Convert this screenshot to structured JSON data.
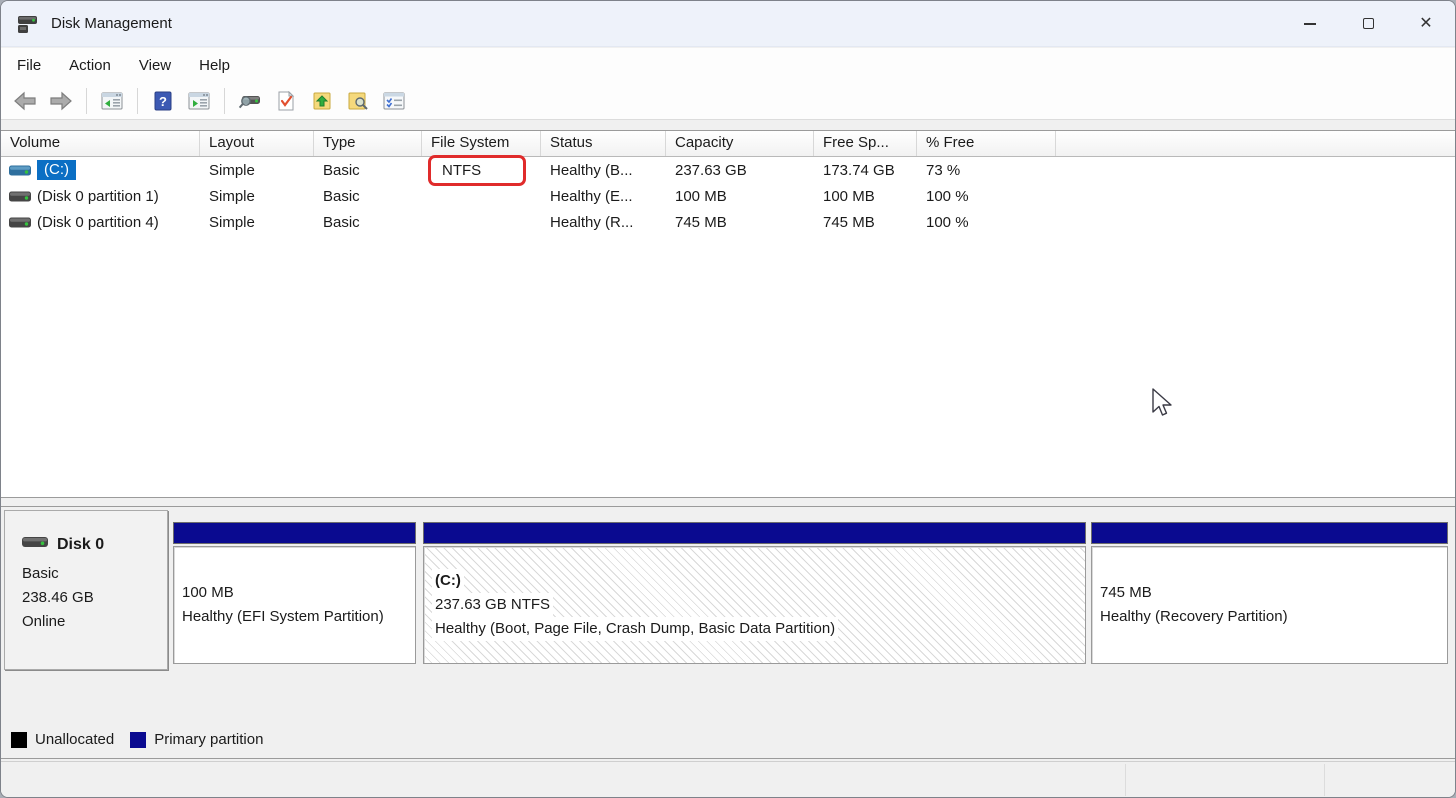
{
  "window": {
    "title": "Disk Management",
    "controls": [
      "minimize",
      "maximize",
      "close"
    ]
  },
  "menu": {
    "items": [
      "File",
      "Action",
      "View",
      "Help"
    ]
  },
  "toolbar": {
    "icons": [
      "back",
      "forward",
      "show-console-tree",
      "help",
      "show-action-pane",
      "rescan-disks",
      "check-document",
      "folder-up",
      "folder-search",
      "checklist"
    ]
  },
  "volume_table": {
    "columns": [
      "Volume",
      "Layout",
      "Type",
      "File System",
      "Status",
      "Capacity",
      "Free Sp...",
      "% Free"
    ],
    "rows": [
      {
        "volume": "(C:)",
        "layout": "Simple",
        "type": "Basic",
        "file_system": "NTFS",
        "status": "Healthy (B...",
        "capacity": "237.63 GB",
        "free_space": "173.74 GB",
        "pct_free": "73 %",
        "selected": true,
        "file_system_annotated": true
      },
      {
        "volume": "(Disk 0 partition 1)",
        "layout": "Simple",
        "type": "Basic",
        "file_system": "",
        "status": "Healthy (E...",
        "capacity": "100 MB",
        "free_space": "100 MB",
        "pct_free": "100 %",
        "selected": false
      },
      {
        "volume": "(Disk 0 partition 4)",
        "layout": "Simple",
        "type": "Basic",
        "file_system": "",
        "status": "Healthy (R...",
        "capacity": "745 MB",
        "free_space": "745 MB",
        "pct_free": "100 %",
        "selected": false
      }
    ]
  },
  "disk_view": {
    "disk": {
      "name": "Disk 0",
      "type": "Basic",
      "size": "238.46 GB",
      "status": "Online"
    },
    "partitions": [
      {
        "id": "efi",
        "lines": {
          "0": "100 MB",
          "1": "Healthy (EFI System Partition)"
        },
        "hatched": false
      },
      {
        "id": "c",
        "label": "(C:)",
        "lines": {
          "0": "237.63 GB NTFS",
          "1": "Healthy (Boot, Page File, Crash Dump, Basic Data Partition)"
        },
        "hatched": true
      },
      {
        "id": "recovery",
        "lines": {
          "0": "745 MB",
          "1": "Healthy (Recovery Partition)"
        },
        "hatched": false
      }
    ]
  },
  "legend": {
    "items": [
      {
        "label": "Unallocated",
        "color": "#000000"
      },
      {
        "label": "Primary partition",
        "color": "#0a0a90"
      }
    ]
  },
  "colors": {
    "titlebar_bg": "#eef2fa",
    "selection_blue": "#0b6fc4",
    "partition_bar_navy": "#0a0a90",
    "annotation_red": "#e02b2b",
    "pane_bg": "#f0f0f0"
  }
}
